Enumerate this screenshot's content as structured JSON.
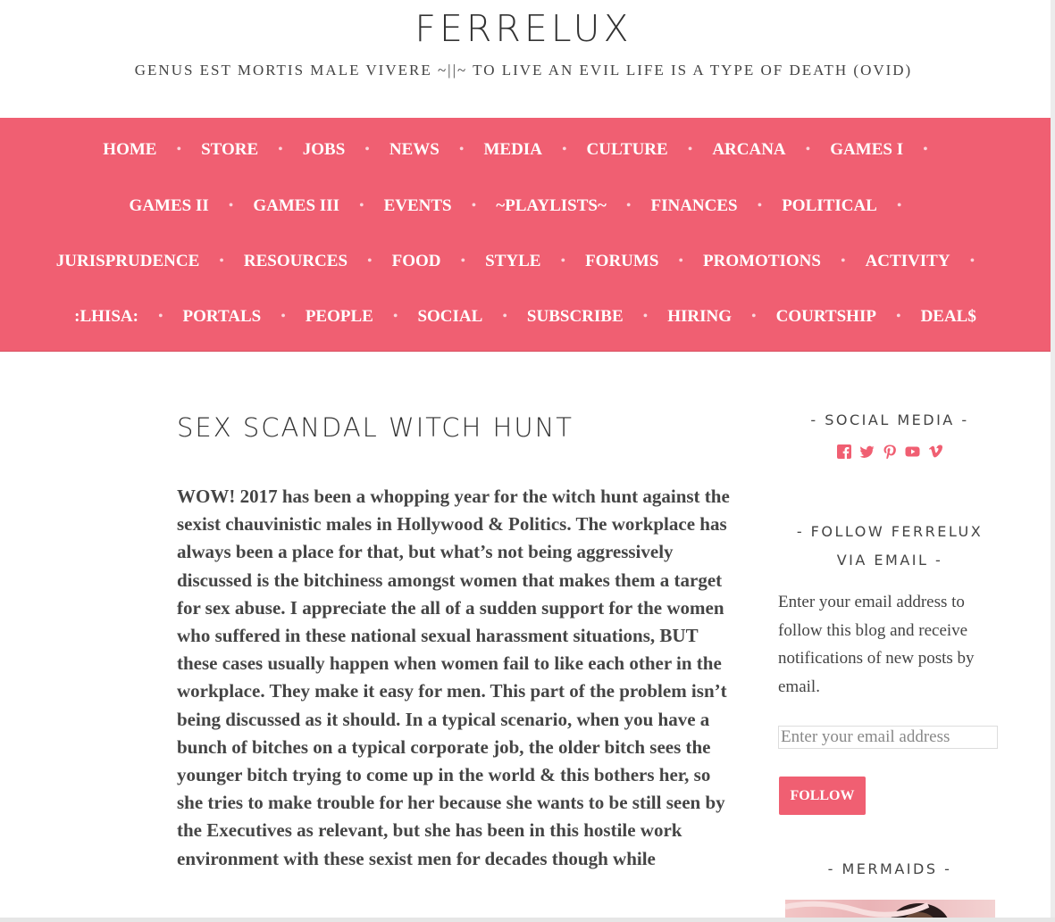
{
  "header": {
    "site_title": "FERRELUX",
    "tagline": "GENUS EST MORTIS MALE VIVERE ~||~ TO LIVE AN EVIL LIFE IS A TYPE OF DEATH (OVID)"
  },
  "nav": {
    "rows": [
      [
        "HOME",
        "STORE",
        "JOBS",
        "NEWS",
        "MEDIA",
        "CULTURE",
        "ARCANA",
        "GAMES I"
      ],
      [
        "GAMES II",
        "GAMES III",
        "EVENTS",
        "~PLAYLISTS~",
        "FINANCES",
        "POLITICAL"
      ],
      [
        "JURISPRUDENCE",
        "RESOURCES",
        "FOOD",
        "STYLE",
        "FORUMS",
        "PROMOTIONS",
        "ACTIVITY"
      ],
      [
        ":LHISA:",
        "PORTALS",
        "PEOPLE",
        "SOCIAL",
        "SUBSCRIBE",
        "HIRING",
        "COURTSHIP",
        "DEAL$"
      ]
    ],
    "separator": "•"
  },
  "post": {
    "title": "SEX SCANDAL WITCH HUNT",
    "body": "WOW! 2017 has been a whopping year for the witch hunt against the sexist chauvinistic males in Hollywood & Politics. The workplace has always been a place for that, but what’s not being aggressively discussed is the bitchiness amongst  women that makes them a target for sex abuse. I appreciate the all of a sudden support for the women who suffered in these national sexual harassment situations, BUT these cases usually happen when women fail to like each other in the workplace. They make it easy for men. This part of the problem isn’t being discussed as it should. In a typical scenario, when you have a bunch of bitches on a typical corporate job, the older bitch sees the younger bitch trying to come up in the world & this bothers her, so she tries to make trouble for her because she wants to be still seen by the Executives as relevant, but she has been in this hostile work environment with these sexist men for decades though while"
  },
  "sidebar": {
    "social_title": "- SOCIAL MEDIA -",
    "social_icons": [
      "facebook-icon",
      "twitter-icon",
      "pinterest-icon",
      "youtube-icon",
      "vimeo-icon"
    ],
    "accent_color": "#f05f72",
    "follow_title": "- FOLLOW FERRELUX VIA EMAIL -",
    "follow_desc": "Enter your email address to follow this blog and receive notifications of new posts by email.",
    "email_placeholder": "Enter your email address",
    "follow_button": "FOLLOW",
    "mermaids_title": "- MERMAIDS -"
  }
}
